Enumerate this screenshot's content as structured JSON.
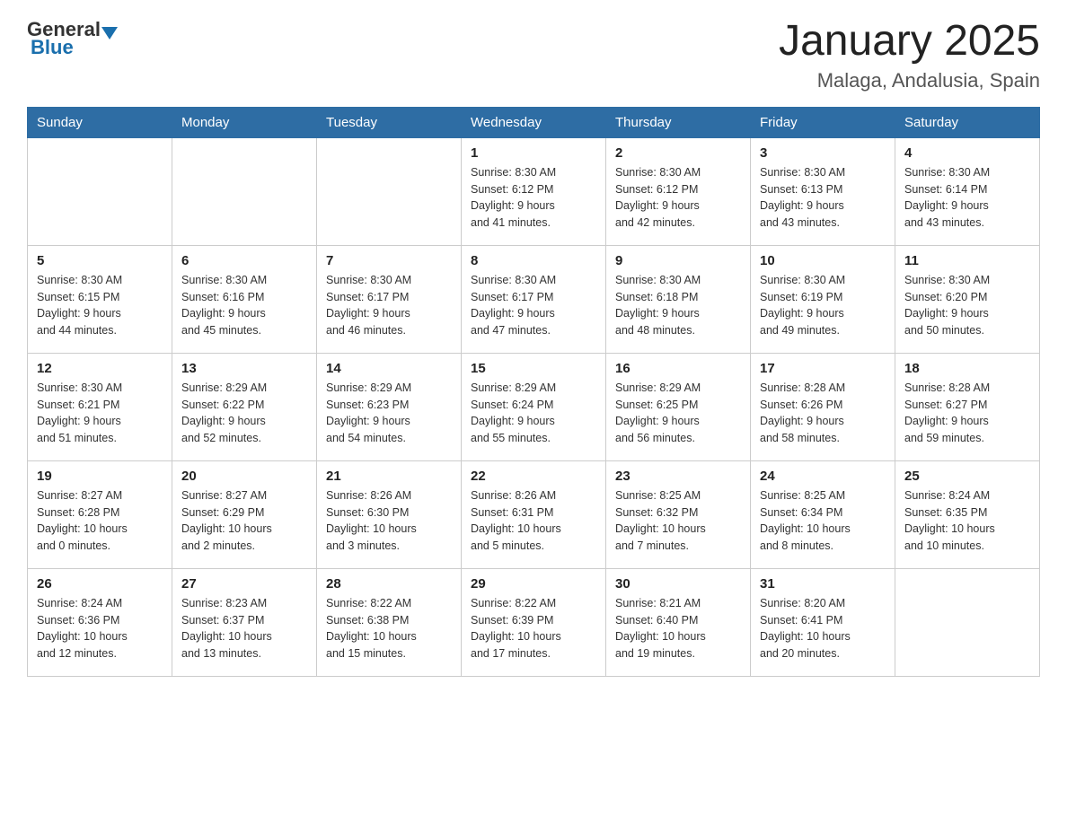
{
  "header": {
    "logo_general": "General",
    "logo_blue": "Blue",
    "title": "January 2025",
    "subtitle": "Malaga, Andalusia, Spain"
  },
  "weekdays": [
    "Sunday",
    "Monday",
    "Tuesday",
    "Wednesday",
    "Thursday",
    "Friday",
    "Saturday"
  ],
  "weeks": [
    [
      {
        "day": "",
        "info": ""
      },
      {
        "day": "",
        "info": ""
      },
      {
        "day": "",
        "info": ""
      },
      {
        "day": "1",
        "info": "Sunrise: 8:30 AM\nSunset: 6:12 PM\nDaylight: 9 hours\nand 41 minutes."
      },
      {
        "day": "2",
        "info": "Sunrise: 8:30 AM\nSunset: 6:12 PM\nDaylight: 9 hours\nand 42 minutes."
      },
      {
        "day": "3",
        "info": "Sunrise: 8:30 AM\nSunset: 6:13 PM\nDaylight: 9 hours\nand 43 minutes."
      },
      {
        "day": "4",
        "info": "Sunrise: 8:30 AM\nSunset: 6:14 PM\nDaylight: 9 hours\nand 43 minutes."
      }
    ],
    [
      {
        "day": "5",
        "info": "Sunrise: 8:30 AM\nSunset: 6:15 PM\nDaylight: 9 hours\nand 44 minutes."
      },
      {
        "day": "6",
        "info": "Sunrise: 8:30 AM\nSunset: 6:16 PM\nDaylight: 9 hours\nand 45 minutes."
      },
      {
        "day": "7",
        "info": "Sunrise: 8:30 AM\nSunset: 6:17 PM\nDaylight: 9 hours\nand 46 minutes."
      },
      {
        "day": "8",
        "info": "Sunrise: 8:30 AM\nSunset: 6:17 PM\nDaylight: 9 hours\nand 47 minutes."
      },
      {
        "day": "9",
        "info": "Sunrise: 8:30 AM\nSunset: 6:18 PM\nDaylight: 9 hours\nand 48 minutes."
      },
      {
        "day": "10",
        "info": "Sunrise: 8:30 AM\nSunset: 6:19 PM\nDaylight: 9 hours\nand 49 minutes."
      },
      {
        "day": "11",
        "info": "Sunrise: 8:30 AM\nSunset: 6:20 PM\nDaylight: 9 hours\nand 50 minutes."
      }
    ],
    [
      {
        "day": "12",
        "info": "Sunrise: 8:30 AM\nSunset: 6:21 PM\nDaylight: 9 hours\nand 51 minutes."
      },
      {
        "day": "13",
        "info": "Sunrise: 8:29 AM\nSunset: 6:22 PM\nDaylight: 9 hours\nand 52 minutes."
      },
      {
        "day": "14",
        "info": "Sunrise: 8:29 AM\nSunset: 6:23 PM\nDaylight: 9 hours\nand 54 minutes."
      },
      {
        "day": "15",
        "info": "Sunrise: 8:29 AM\nSunset: 6:24 PM\nDaylight: 9 hours\nand 55 minutes."
      },
      {
        "day": "16",
        "info": "Sunrise: 8:29 AM\nSunset: 6:25 PM\nDaylight: 9 hours\nand 56 minutes."
      },
      {
        "day": "17",
        "info": "Sunrise: 8:28 AM\nSunset: 6:26 PM\nDaylight: 9 hours\nand 58 minutes."
      },
      {
        "day": "18",
        "info": "Sunrise: 8:28 AM\nSunset: 6:27 PM\nDaylight: 9 hours\nand 59 minutes."
      }
    ],
    [
      {
        "day": "19",
        "info": "Sunrise: 8:27 AM\nSunset: 6:28 PM\nDaylight: 10 hours\nand 0 minutes."
      },
      {
        "day": "20",
        "info": "Sunrise: 8:27 AM\nSunset: 6:29 PM\nDaylight: 10 hours\nand 2 minutes."
      },
      {
        "day": "21",
        "info": "Sunrise: 8:26 AM\nSunset: 6:30 PM\nDaylight: 10 hours\nand 3 minutes."
      },
      {
        "day": "22",
        "info": "Sunrise: 8:26 AM\nSunset: 6:31 PM\nDaylight: 10 hours\nand 5 minutes."
      },
      {
        "day": "23",
        "info": "Sunrise: 8:25 AM\nSunset: 6:32 PM\nDaylight: 10 hours\nand 7 minutes."
      },
      {
        "day": "24",
        "info": "Sunrise: 8:25 AM\nSunset: 6:34 PM\nDaylight: 10 hours\nand 8 minutes."
      },
      {
        "day": "25",
        "info": "Sunrise: 8:24 AM\nSunset: 6:35 PM\nDaylight: 10 hours\nand 10 minutes."
      }
    ],
    [
      {
        "day": "26",
        "info": "Sunrise: 8:24 AM\nSunset: 6:36 PM\nDaylight: 10 hours\nand 12 minutes."
      },
      {
        "day": "27",
        "info": "Sunrise: 8:23 AM\nSunset: 6:37 PM\nDaylight: 10 hours\nand 13 minutes."
      },
      {
        "day": "28",
        "info": "Sunrise: 8:22 AM\nSunset: 6:38 PM\nDaylight: 10 hours\nand 15 minutes."
      },
      {
        "day": "29",
        "info": "Sunrise: 8:22 AM\nSunset: 6:39 PM\nDaylight: 10 hours\nand 17 minutes."
      },
      {
        "day": "30",
        "info": "Sunrise: 8:21 AM\nSunset: 6:40 PM\nDaylight: 10 hours\nand 19 minutes."
      },
      {
        "day": "31",
        "info": "Sunrise: 8:20 AM\nSunset: 6:41 PM\nDaylight: 10 hours\nand 20 minutes."
      },
      {
        "day": "",
        "info": ""
      }
    ]
  ]
}
